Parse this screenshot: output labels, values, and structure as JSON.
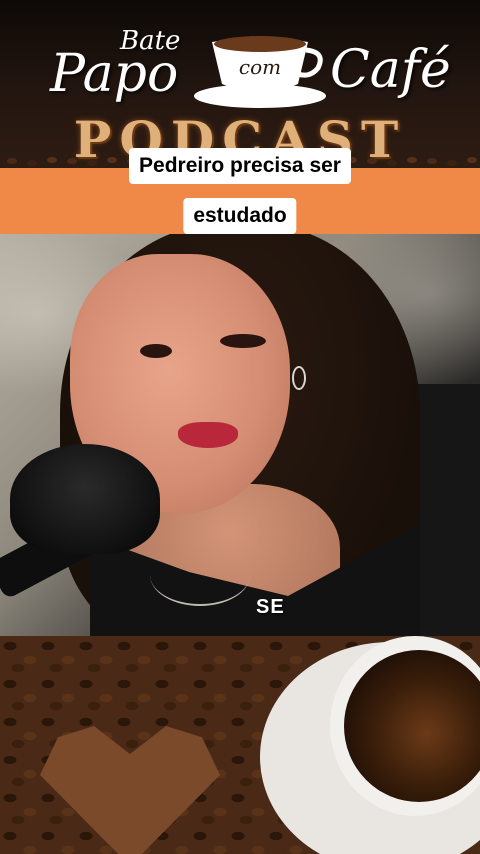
{
  "header": {
    "logo_bate": "Bate",
    "logo_papo": "Papo",
    "logo_com": "com",
    "logo_cafe": "Café",
    "podcast": "PODCAST"
  },
  "title": {
    "line1": "Pedreiro precisa ser",
    "line2": "estudado"
  },
  "video": {
    "subtitle": "SE"
  },
  "colors": {
    "title_band": "#f08848",
    "title_box": "#ffffff"
  }
}
